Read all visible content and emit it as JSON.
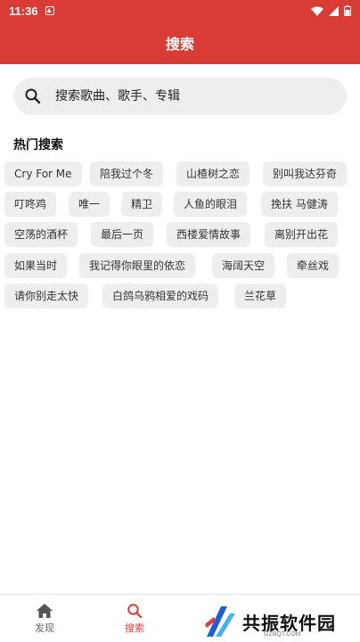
{
  "status_bar": {
    "time": "11:36"
  },
  "app_bar": {
    "title": "搜索"
  },
  "search": {
    "placeholder": "搜索歌曲、歌手、专辑"
  },
  "hot": {
    "title": "热门搜索",
    "tags": [
      "Cry For Me",
      "陪我过个冬",
      "山楂树之恋",
      "别叫我达芬奇",
      "叮咚鸡",
      "唯一",
      "精卫",
      "人鱼的眼泪",
      "挽扶 马健涛",
      "空荡的酒杯",
      "最后一页",
      "西楼爱情故事",
      "离别开出花",
      "如果当时",
      "我记得你眼里的依恋",
      "海阔天空",
      "牵丝戏",
      "请你别走太快",
      "白鸽乌鸦相爱的戏码",
      "兰花草"
    ]
  },
  "bottom_nav": {
    "discover": "发现",
    "search": "搜索"
  },
  "colors": {
    "accent": "#d93c34",
    "chip_bg": "#eeeeee",
    "search_bg": "#eeeeee"
  },
  "watermark": {
    "text": "共振软件园",
    "sub": "GZBQT.COM"
  }
}
